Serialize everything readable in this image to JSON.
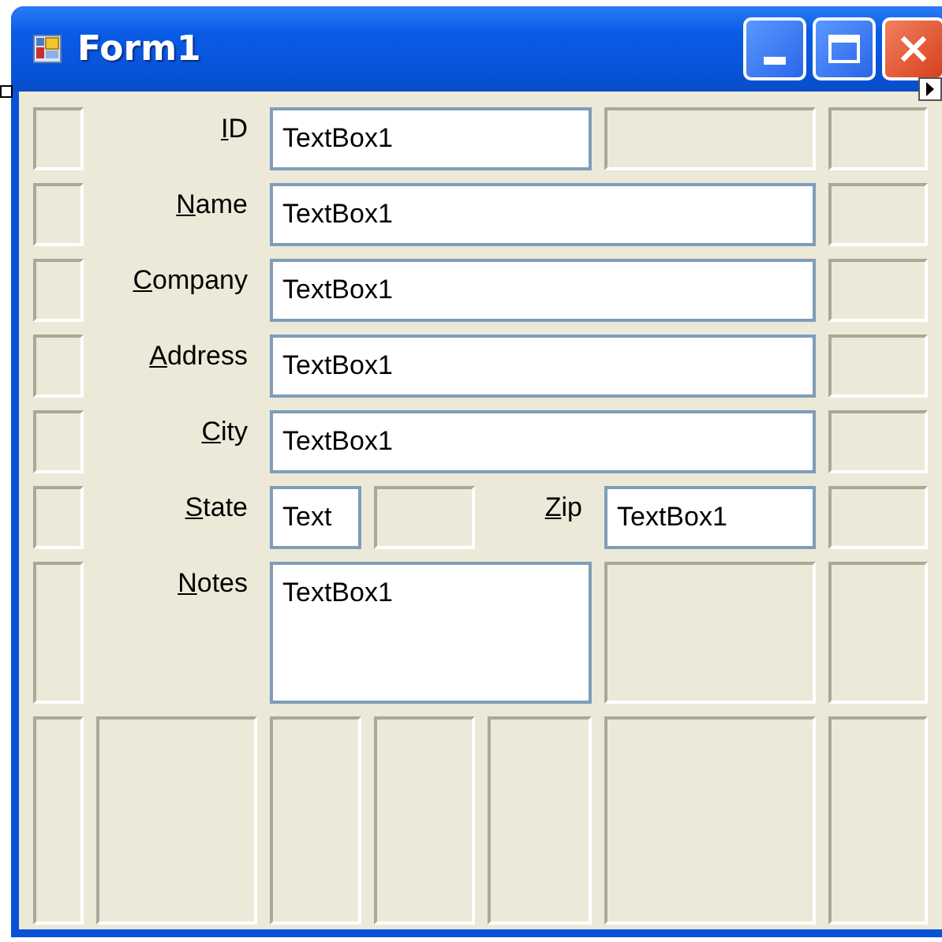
{
  "window": {
    "title": "Form1"
  },
  "fields": [
    {
      "label": {
        "access_key": "I",
        "rest": "D"
      },
      "value": "TextBox1"
    },
    {
      "label": {
        "access_key": "N",
        "rest": "ame"
      },
      "value": "TextBox1"
    },
    {
      "label": {
        "access_key": "C",
        "rest": "ompany"
      },
      "value": "TextBox1"
    },
    {
      "label": {
        "access_key": "A",
        "rest": "ddress"
      },
      "value": "TextBox1"
    },
    {
      "label": {
        "access_key": "C",
        "rest": "ity"
      },
      "value": "TextBox1"
    },
    {
      "label": {
        "access_key": "S",
        "rest": "tate"
      },
      "value": "Text"
    },
    {
      "label": {
        "access_key": "Z",
        "rest": "ip"
      },
      "value": "TextBox1"
    },
    {
      "label": {
        "access_key": "N",
        "rest": "otes"
      },
      "value": "TextBox1"
    }
  ]
}
